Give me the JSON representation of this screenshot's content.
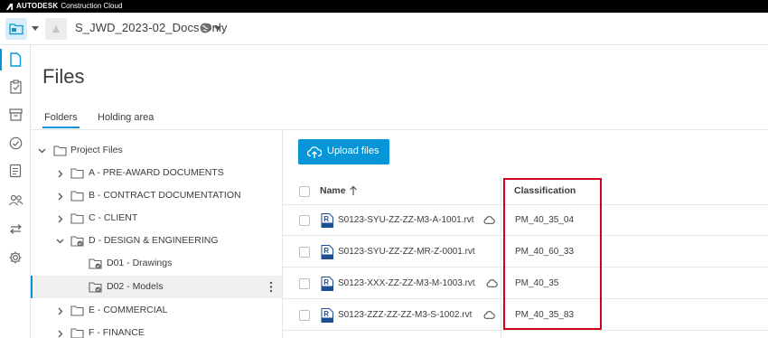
{
  "brand": {
    "company": "AUTODESK",
    "product": "Construction Cloud"
  },
  "project": {
    "name": "S_JWD_2023-02_Docs Only",
    "switcher_icon": "folder-switch-icon",
    "globe_icon": "globe-icon"
  },
  "rail": {
    "items": [
      {
        "icon": "file-icon",
        "active": true
      },
      {
        "icon": "clipboard-icon",
        "active": false
      },
      {
        "icon": "archive-icon",
        "active": false
      },
      {
        "icon": "check-circle-icon",
        "active": false
      },
      {
        "icon": "checklist-icon",
        "active": false
      },
      {
        "icon": "members-icon",
        "active": false
      },
      {
        "icon": "transfer-icon",
        "active": false
      },
      {
        "icon": "settings-icon",
        "active": false
      }
    ]
  },
  "page": {
    "title": "Files"
  },
  "tabs": [
    {
      "label": "Folders",
      "active": true
    },
    {
      "label": "Holding area",
      "active": false
    }
  ],
  "tree": {
    "items": [
      {
        "label": "Project Files",
        "level": 0,
        "expanded": true
      },
      {
        "label": "A - PRE-AWARD DOCUMENTS",
        "level": 1
      },
      {
        "label": "B - CONTRACT DOCUMENTATION",
        "level": 1
      },
      {
        "label": "C - CLIENT",
        "level": 1
      },
      {
        "label": "D - DESIGN & ENGINEERING",
        "level": 1,
        "expanded": true
      },
      {
        "label": "D01 - Drawings",
        "level": 2
      },
      {
        "label": "D02 - Models",
        "level": 2,
        "selected": true
      },
      {
        "label": "E - COMMERCIAL",
        "level": 1
      },
      {
        "label": "F - FINANCE",
        "level": 1
      }
    ]
  },
  "toolbar": {
    "upload_label": "Upload files"
  },
  "list": {
    "columns": {
      "name": "Name",
      "classification": "Classification"
    },
    "rows": [
      {
        "name": "S0123-SYU-ZZ-ZZ-M3-A-1001.rvt",
        "classification": "PM_40_35_04",
        "cloud": true
      },
      {
        "name": "S0123-SYU-ZZ-ZZ-MR-Z-0001.rvt",
        "classification": "PM_40_60_33",
        "cloud": false
      },
      {
        "name": "S0123-XXX-ZZ-ZZ-M3-M-1003.rvt",
        "classification": "PM_40_35",
        "cloud": true
      },
      {
        "name": "S0123-ZZZ-ZZ-ZZ-M3-S-1002.rvt",
        "classification": "PM_40_35_83",
        "cloud": true
      }
    ]
  },
  "colors": {
    "accent": "#0696d7",
    "highlight": "#d0021b",
    "revit_blue": "#1d4f91"
  }
}
